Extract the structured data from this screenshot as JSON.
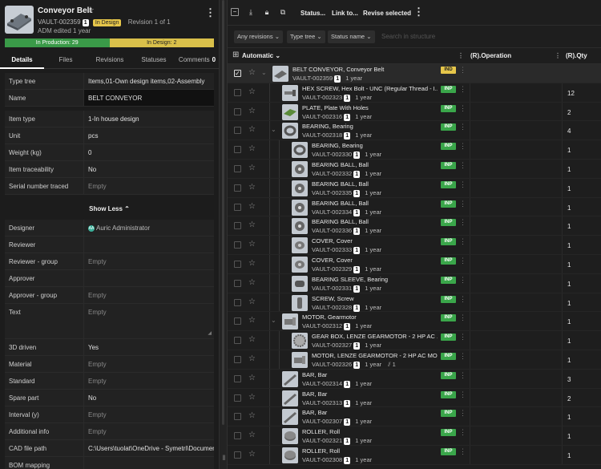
{
  "header": {
    "title": "Conveyor Belt",
    "vault_id": "VAULT-002359",
    "version": "1",
    "state": "In Design",
    "revision": "Revision 1 of 1",
    "edited": "ADM edited 1 year",
    "progress": [
      {
        "label": "In Production: 29",
        "fraction": 0.5,
        "color": "#3a9a48"
      },
      {
        "label": "In Design: 2",
        "fraction": 0.5,
        "color": "#d9c04a"
      }
    ]
  },
  "tabs": [
    {
      "label": "Details",
      "active": true
    },
    {
      "label": "Files"
    },
    {
      "label": "Revisions"
    },
    {
      "label": "Statuses"
    },
    {
      "label": "Comments",
      "count": "0"
    }
  ],
  "properties_top": [
    {
      "key": "Type tree",
      "value": "Items,01-Own design items,02-Assembly"
    },
    {
      "key": "Name",
      "value": "BELT CONVEYOR"
    }
  ],
  "properties_mid": [
    {
      "key": "Item type",
      "value": "1-In house design"
    },
    {
      "key": "Unit",
      "value": "pcs"
    },
    {
      "key": "Weight (kg)",
      "value": "0"
    },
    {
      "key": "Item traceability",
      "value": "No"
    },
    {
      "key": "Serial number traced",
      "value": "Empty"
    }
  ],
  "show_less": "Show Less",
  "properties_bottom": [
    {
      "key": "Designer",
      "value": "Auric Administrator",
      "avatar": "AA"
    },
    {
      "key": "Reviewer",
      "value": ""
    },
    {
      "key": "Reviewer - group",
      "value": "Empty"
    },
    {
      "key": "Approver",
      "value": ""
    },
    {
      "key": "Approver - group",
      "value": "Empty"
    },
    {
      "key": "Text",
      "value": "Empty"
    },
    {
      "key": "3D driven",
      "value": "Yes"
    },
    {
      "key": "Material",
      "value": "Empty"
    },
    {
      "key": "Standard",
      "value": "Empty"
    },
    {
      "key": "Spare part",
      "value": "No"
    },
    {
      "key": "Interval (y)",
      "value": "Empty"
    },
    {
      "key": "Additional info",
      "value": "Empty"
    },
    {
      "key": "CAD file path",
      "value": "C:\\Users\\tuolat\\OneDrive - Symetri\\Documen..."
    },
    {
      "key": "BOM mapping",
      "value": ""
    }
  ],
  "toolbar": {
    "status_label": "Status...",
    "link_label": "Link to...",
    "revise_label": "Revise selected"
  },
  "filters": {
    "revisions": "Any revisions",
    "type_tree": "Type tree",
    "status_name": "Status name",
    "search_placeholder": "Search in structure"
  },
  "columns": {
    "name": "Automatic",
    "operation": "(R).Operation",
    "qty": "(R).Qty"
  },
  "rows": [
    {
      "name": "BELT CONVEYOR, Conveyor Belt",
      "vault": "VAULT-002359",
      "ver": "1",
      "age": "1 year",
      "status": "IND",
      "qty": "",
      "level": 0,
      "expand": true,
      "selected": true
    },
    {
      "name": "HEX SCREW, Hex Bolt - UNC (Regular Thread - I...",
      "vault": "VAULT-002323",
      "ver": "1",
      "age": "1 year",
      "status": "INP",
      "qty": "12",
      "level": 1
    },
    {
      "name": "PLATE, Plate With Holes",
      "vault": "VAULT-002316",
      "ver": "1",
      "age": "1 year",
      "status": "INP",
      "qty": "2",
      "level": 1
    },
    {
      "name": "BEARING, Bearing",
      "vault": "VAULT-002318",
      "ver": "1",
      "age": "1 year",
      "status": "INP",
      "qty": "4",
      "level": 1,
      "expand": true
    },
    {
      "name": "BEARING, Bearing",
      "vault": "VAULT-002330",
      "ver": "1",
      "age": "1 year",
      "status": "INP",
      "qty": "1",
      "level": 2
    },
    {
      "name": "BEARING BALL, Ball",
      "vault": "VAULT-002332",
      "ver": "1",
      "age": "1 year",
      "status": "INP",
      "qty": "1",
      "level": 2
    },
    {
      "name": "BEARING BALL, Ball",
      "vault": "VAULT-002335",
      "ver": "1",
      "age": "1 year",
      "status": "INP",
      "qty": "1",
      "level": 2
    },
    {
      "name": "BEARING BALL, Ball",
      "vault": "VAULT-002334",
      "ver": "1",
      "age": "1 year",
      "status": "INP",
      "qty": "1",
      "level": 2
    },
    {
      "name": "BEARING BALL, Ball",
      "vault": "VAULT-002336",
      "ver": "1",
      "age": "1 year",
      "status": "INP",
      "qty": "1",
      "level": 2
    },
    {
      "name": "COVER, Cover",
      "vault": "VAULT-002333",
      "ver": "1",
      "age": "1 year",
      "status": "INP",
      "qty": "1",
      "level": 2
    },
    {
      "name": "COVER, Cover",
      "vault": "VAULT-002329",
      "ver": "1",
      "age": "1 year",
      "status": "INP",
      "qty": "1",
      "level": 2
    },
    {
      "name": "BEARING SLEEVE, Bearing",
      "vault": "VAULT-002331",
      "ver": "1",
      "age": "1 year",
      "status": "INP",
      "qty": "1",
      "level": 2
    },
    {
      "name": "SCREW, Screw",
      "vault": "VAULT-002328",
      "ver": "1",
      "age": "1 year",
      "status": "INP",
      "qty": "1",
      "level": 2
    },
    {
      "name": "MOTOR, Gearmotor",
      "vault": "VAULT-002312",
      "ver": "1",
      "age": "1 year",
      "status": "INP",
      "qty": "1",
      "level": 1,
      "expand": true
    },
    {
      "name": "GEAR BOX, LENZE GEARMOTOR - 2 HP AC ...",
      "vault": "VAULT-002327",
      "ver": "1",
      "age": "1 year",
      "status": "INP",
      "qty": "1",
      "level": 2
    },
    {
      "name": "MOTOR, LENZE GEARMOTOR - 2 HP AC MO...",
      "vault": "VAULT-002326",
      "ver": "1",
      "age": "1 year",
      "status": "INP",
      "qty": "1",
      "level": 2,
      "attachments": "1"
    },
    {
      "name": "BAR, Bar",
      "vault": "VAULT-002314",
      "ver": "1",
      "age": "1 year",
      "status": "INP",
      "qty": "3",
      "level": 1
    },
    {
      "name": "BAR, Bar",
      "vault": "VAULT-002313",
      "ver": "1",
      "age": "1 year",
      "status": "INP",
      "qty": "2",
      "level": 1
    },
    {
      "name": "BAR, Bar",
      "vault": "VAULT-002307",
      "ver": "1",
      "age": "1 year",
      "status": "INP",
      "qty": "1",
      "level": 1
    },
    {
      "name": "ROLLER, Roll",
      "vault": "VAULT-002321",
      "ver": "1",
      "age": "1 year",
      "status": "INP",
      "qty": "1",
      "level": 1
    },
    {
      "name": "ROLLER, Roll",
      "vault": "VAULT-002308",
      "ver": "1",
      "age": "1 year",
      "status": "INP",
      "qty": "1",
      "level": 1
    }
  ]
}
